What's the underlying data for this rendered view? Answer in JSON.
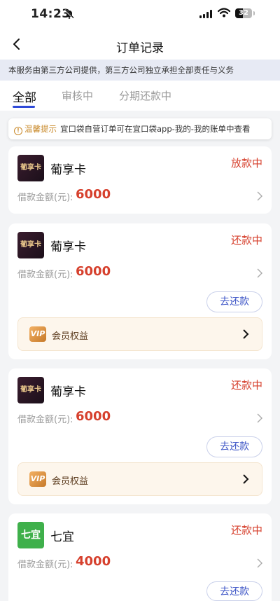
{
  "status_bar": {
    "time": "14:23",
    "battery": "32"
  },
  "nav": {
    "title": "订单记录"
  },
  "notice": "本服务由第三方公司提供，第三方公司独立承担全部责任与义务",
  "tabs": [
    {
      "label": "全部",
      "active": true
    },
    {
      "label": "审核中",
      "active": false
    },
    {
      "label": "分期还款中",
      "active": false
    }
  ],
  "tip": {
    "title": "温馨提示",
    "text": "宜口袋自营订单可在宜口袋app-我的-我的账单中查看"
  },
  "orders": [
    {
      "logo": "葡享卡",
      "name": "葡享卡",
      "status": "放款中",
      "amount_label": "借款金额(元):",
      "amount": "6000"
    },
    {
      "logo": "葡享卡",
      "name": "葡享卡",
      "status": "还款中",
      "amount_label": "借款金额(元):",
      "amount": "6000",
      "repay_label": "去还款",
      "benefit_label": "会员权益",
      "vip_icon": "VIP"
    },
    {
      "logo": "葡享卡",
      "name": "葡享卡",
      "status": "还款中",
      "amount_label": "借款金额(元):",
      "amount": "6000",
      "repay_label": "去还款",
      "benefit_label": "会员权益",
      "vip_icon": "VIP"
    },
    {
      "logo": "七宜",
      "name": "七宜",
      "status": "还款中",
      "amount_label": "借款金额(元):",
      "amount": "4000",
      "repay_label": "去还款"
    }
  ],
  "colors": {
    "accent": "#2f4ad8",
    "status_red": "#d6402d",
    "warning": "#c98a2b"
  }
}
